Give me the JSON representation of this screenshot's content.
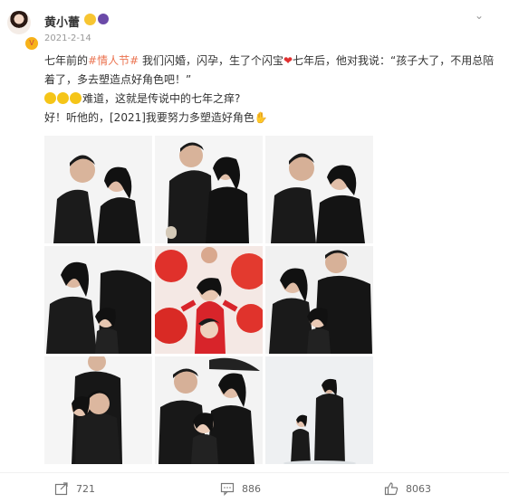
{
  "user": {
    "name": "黄小蕾",
    "timestamp": "2021-2-14"
  },
  "post": {
    "line1_pre": "七年前的",
    "hashtag": "#情人节#",
    "line1_mid": " 我们闪婚，闪孕，生了个闪宝",
    "line1_post": "七年后，他对我说：“孩子大了，不用总陪着了，多去塑造点好角色吧！”",
    "line2": "难道，这就是传说中的七年之痒?",
    "line3": "好！听他的，[2021]我要努力多塑造好角色"
  },
  "actions": {
    "repost_count": "721",
    "comment_count": "886",
    "like_count": "8063"
  },
  "icons": [
    "more-icon",
    "repost-icon",
    "comment-icon",
    "like-icon",
    "heart-emoji",
    "laugh-emoji",
    "muscle-emoji"
  ],
  "colors": {
    "hashtag": "#eb7350",
    "heart": "#e03030",
    "accent_gold": "#f7b21a"
  }
}
